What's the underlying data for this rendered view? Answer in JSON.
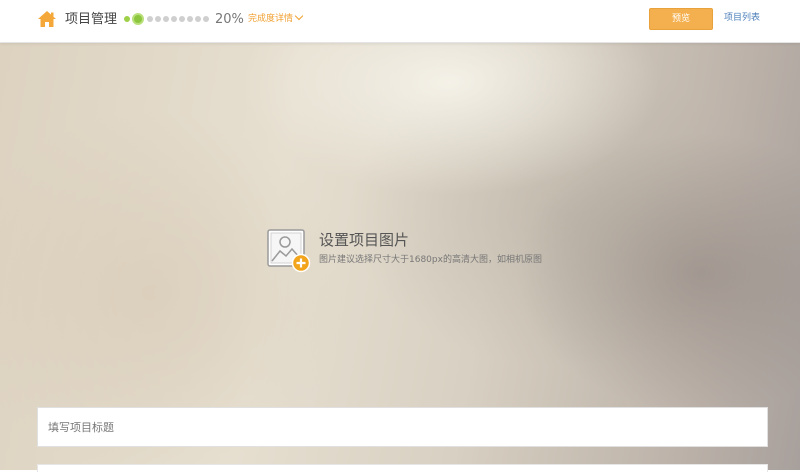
{
  "header": {
    "home_icon": "home-icon",
    "title": "项目管理",
    "progress": {
      "percent_label": "20%",
      "percent_value": 20,
      "total_steps": 10,
      "current_step": 2
    },
    "detail_link": "完成度详情",
    "preview_button": "预览",
    "project_list_link": "项目列表"
  },
  "cover": {
    "icon": "image-add-icon",
    "title": "设置项目图片",
    "hint": "图片建议选择尺寸大于1680px的高清大图，如相机原图"
  },
  "title_input": {
    "placeholder": "填写项目标题",
    "value": ""
  },
  "colors": {
    "accent": "#f4b04e",
    "progress_done": "#8cc63f",
    "progress_todo": "#cfcfcf",
    "link": "#4a7db8",
    "home_icon": "#f4a83a"
  }
}
